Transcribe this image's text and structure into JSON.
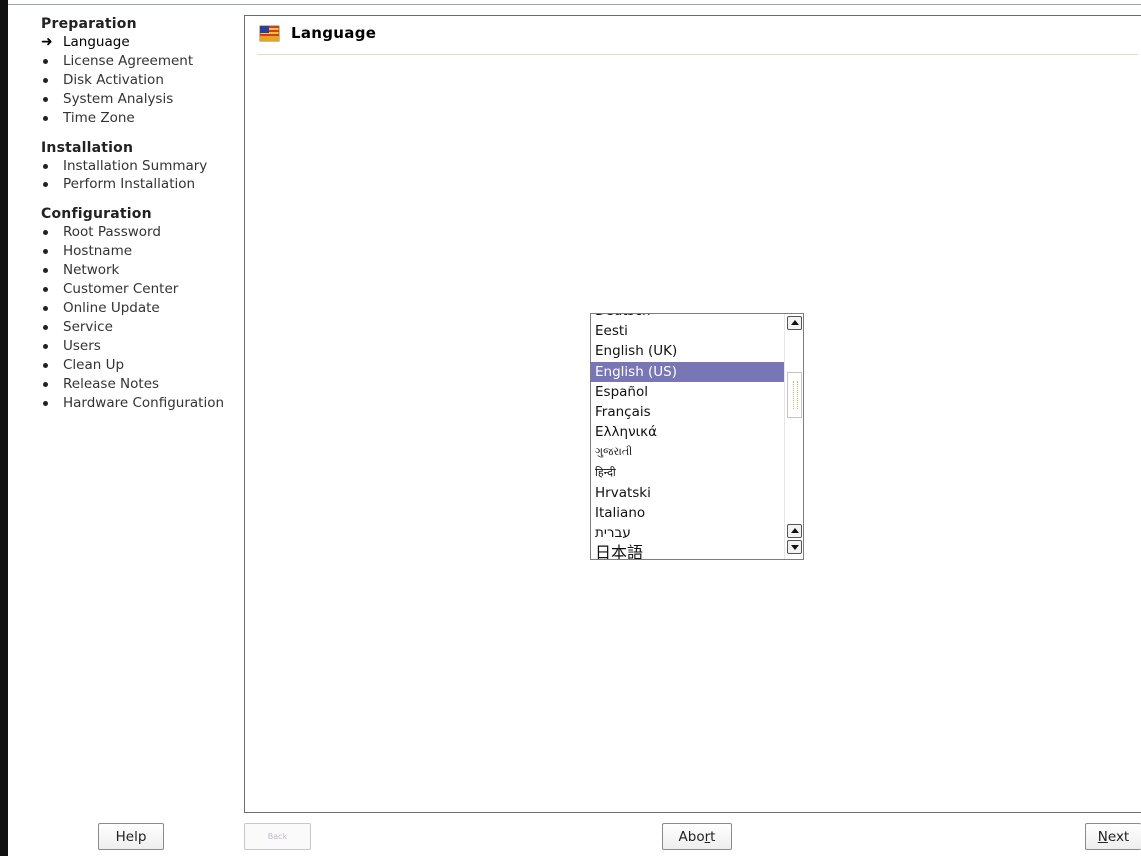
{
  "sidebar": {
    "groups": [
      {
        "title": "Preparation",
        "items": [
          "Language",
          "License Agreement",
          "Disk Activation",
          "System Analysis",
          "Time Zone"
        ]
      },
      {
        "title": "Installation",
        "items": [
          "Installation Summary",
          "Perform Installation"
        ]
      },
      {
        "title": "Configuration",
        "items": [
          "Root Password",
          "Hostname",
          "Network",
          "Customer Center",
          "Online Update",
          "Service",
          "Users",
          "Clean Up",
          "Release Notes",
          "Hardware Configuration"
        ]
      }
    ],
    "current_step": "Language"
  },
  "header": {
    "title": "Language",
    "icon": "language-flag-icon"
  },
  "language_list": {
    "items": [
      "Deutsch",
      "Eesti",
      "English (UK)",
      "English (US)",
      "Español",
      "Français",
      "Ελληνικά",
      "ગુજરાતી",
      "हिन्दी",
      "Hrvatski",
      "Italiano",
      "עברית",
      "日本語"
    ],
    "selected": "English (US)"
  },
  "buttons": {
    "help": "Help",
    "back": "Back",
    "abort_pre": "Abo",
    "abort_mnemonic": "r",
    "abort_post": "t",
    "next_mnemonic": "N",
    "next_post": "ext"
  },
  "colors": {
    "selection": "#7976b6",
    "header_rule": "#7a8a4e",
    "window_edge": "#111111"
  }
}
